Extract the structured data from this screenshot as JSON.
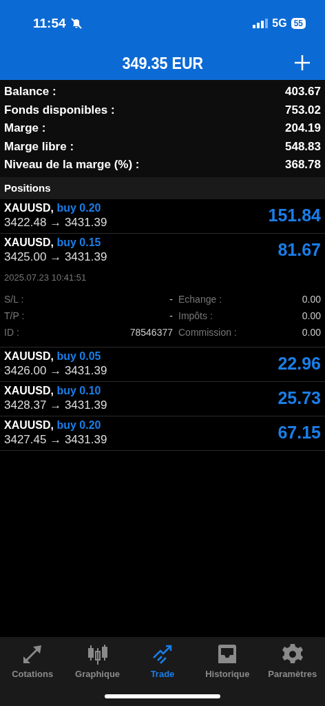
{
  "status_bar": {
    "time": "11:54",
    "network": "5G",
    "battery": "55"
  },
  "header": {
    "title": "349.35 EUR"
  },
  "summary": [
    {
      "label": "Balance :",
      "value": "403.67"
    },
    {
      "label": "Fonds disponibles :",
      "value": "753.02"
    },
    {
      "label": "Marge :",
      "value": "204.19"
    },
    {
      "label": "Marge libre :",
      "value": "548.83"
    },
    {
      "label": "Niveau de la marge (%) :",
      "value": "368.78"
    }
  ],
  "positions_header": "Positions",
  "positions": [
    {
      "symbol": "XAUUSD,",
      "order": "buy 0.20",
      "prices": "3422.48 → 3431.39",
      "profit": "151.84"
    },
    {
      "symbol": "XAUUSD,",
      "order": "buy 0.15",
      "prices": "3425.00 → 3431.39",
      "profit": "81.67",
      "details": {
        "time": "2025.07.23 10:41:51",
        "fields": [
          {
            "label": "S/L :",
            "value": "-",
            "label2": "Echange :",
            "value2": "0.00"
          },
          {
            "label": "T/P :",
            "value": "-",
            "label2": "Impôts :",
            "value2": "0.00"
          },
          {
            "label": "ID :",
            "value": "78546377",
            "label2": "Commission :",
            "value2": "0.00"
          }
        ]
      }
    },
    {
      "symbol": "XAUUSD,",
      "order": "buy 0.05",
      "prices": "3426.00 → 3431.39",
      "profit": "22.96"
    },
    {
      "symbol": "XAUUSD,",
      "order": "buy 0.10",
      "prices": "3428.37 → 3431.39",
      "profit": "25.73"
    },
    {
      "symbol": "XAUUSD,",
      "order": "buy 0.20",
      "prices": "3427.45 → 3431.39",
      "profit": "67.15"
    }
  ],
  "tabs": [
    {
      "label": "Cotations",
      "kind": "quotes",
      "selected": false
    },
    {
      "label": "Graphique",
      "kind": "chart",
      "selected": false
    },
    {
      "label": "Trade",
      "kind": "trade",
      "selected": true
    },
    {
      "label": "Historique",
      "kind": "history",
      "selected": false
    },
    {
      "label": "Paramètres",
      "kind": "settings",
      "selected": false
    }
  ]
}
